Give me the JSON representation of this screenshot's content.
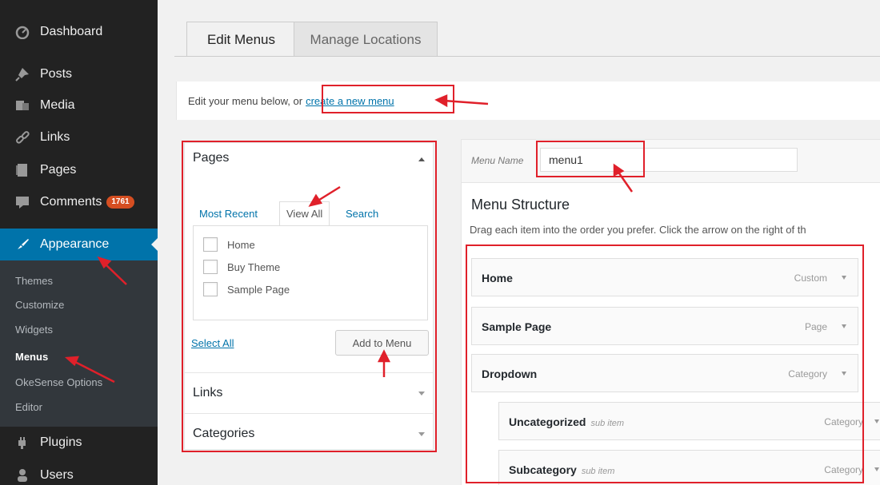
{
  "sidebar": {
    "items": [
      {
        "label": "Dashboard",
        "icon": "dashboard-icon"
      },
      {
        "label": "Posts",
        "icon": "pushpin-icon"
      },
      {
        "label": "Media",
        "icon": "media-icon"
      },
      {
        "label": "Links",
        "icon": "link-icon"
      },
      {
        "label": "Pages",
        "icon": "page-icon"
      },
      {
        "label": "Comments",
        "icon": "comment-icon",
        "badge": "1761"
      },
      {
        "label": "Appearance",
        "icon": "paintbrush-icon"
      },
      {
        "label": "Plugins",
        "icon": "plugin-icon"
      },
      {
        "label": "Users",
        "icon": "users-icon"
      }
    ],
    "submenu": [
      "Themes",
      "Customize",
      "Widgets",
      "Menus",
      "OkeSense Options",
      "Editor"
    ]
  },
  "tabs": {
    "edit": "Edit Menus",
    "manage": "Manage Locations"
  },
  "notice": {
    "text": "Edit your menu below, or",
    "link": "create a new menu"
  },
  "pages_panel": {
    "title": "Pages",
    "tabs": [
      "Most Recent",
      "View All",
      "Search"
    ],
    "items": [
      "Home",
      "Buy Theme",
      "Sample Page"
    ],
    "select_all": "Select All",
    "add_button": "Add to Menu",
    "sections": [
      "Links",
      "Categories"
    ]
  },
  "menu": {
    "name_label": "Menu Name",
    "name_value": "menu1",
    "structure_title": "Menu Structure",
    "structure_desc": "Drag each item into the order you prefer. Click the arrow on the right of th",
    "sub_item_label": "sub item",
    "items": [
      {
        "label": "Home",
        "type": "Custom"
      },
      {
        "label": "Sample Page",
        "type": "Page"
      },
      {
        "label": "Dropdown",
        "type": "Category"
      },
      {
        "label": "Uncategorized",
        "type": "Category"
      },
      {
        "label": "Subcategory",
        "type": "Category"
      }
    ]
  },
  "colors": {
    "highlight": "#e0202a",
    "accent": "#0073aa",
    "sidebar": "#222222"
  }
}
